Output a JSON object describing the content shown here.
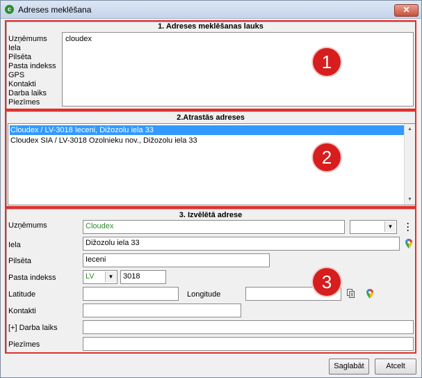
{
  "window": {
    "title": "Adreses meklēšana",
    "close_symbol": "✕"
  },
  "section1": {
    "title": "1. Adreses meklēšanas lauks",
    "labels": [
      "Uzņēmums",
      "Iela",
      "Pilsēta",
      "Pasta indekss",
      "GPS",
      "Kontakti",
      "Darba laiks",
      "Piezīmes"
    ],
    "search_value": "cloudex",
    "badge": "1"
  },
  "section2": {
    "title": "2.Atrastās adreses",
    "results": [
      "Cloudex / LV-3018 Ieceni, Dižozolu iela 33",
      "Cloudex SIA / LV-3018 Ozolnieku nov., Dižozolu iela 33"
    ],
    "badge": "2"
  },
  "section3": {
    "title": "3. Izvēlētā adrese",
    "company_label": "Uzņēmums",
    "company_value": "Cloudex",
    "company_type_value": "",
    "street_label": "Iela",
    "street_value": "Dižozolu iela 33",
    "city_label": "Pilsēta",
    "city_value": "Ieceni",
    "postal_label": "Pasta indekss",
    "country_value": "LV",
    "postal_value": "3018",
    "latitude_label": "Latitude",
    "latitude_value": "",
    "longitude_label": "Longitude",
    "longitude_value": "",
    "contacts_label": "Kontakti",
    "contacts_value": "",
    "hours_label": "[+] Darba laiks",
    "hours_value": "",
    "notes_label": "Piezīmes",
    "notes_value": "",
    "badge": "3"
  },
  "footer": {
    "save_label": "Saglabāt",
    "cancel_label": "Atcelt"
  },
  "colors": {
    "annotation_red": "#e03030",
    "selection_blue": "#3399ff",
    "company_green": "#2d8a2d"
  }
}
